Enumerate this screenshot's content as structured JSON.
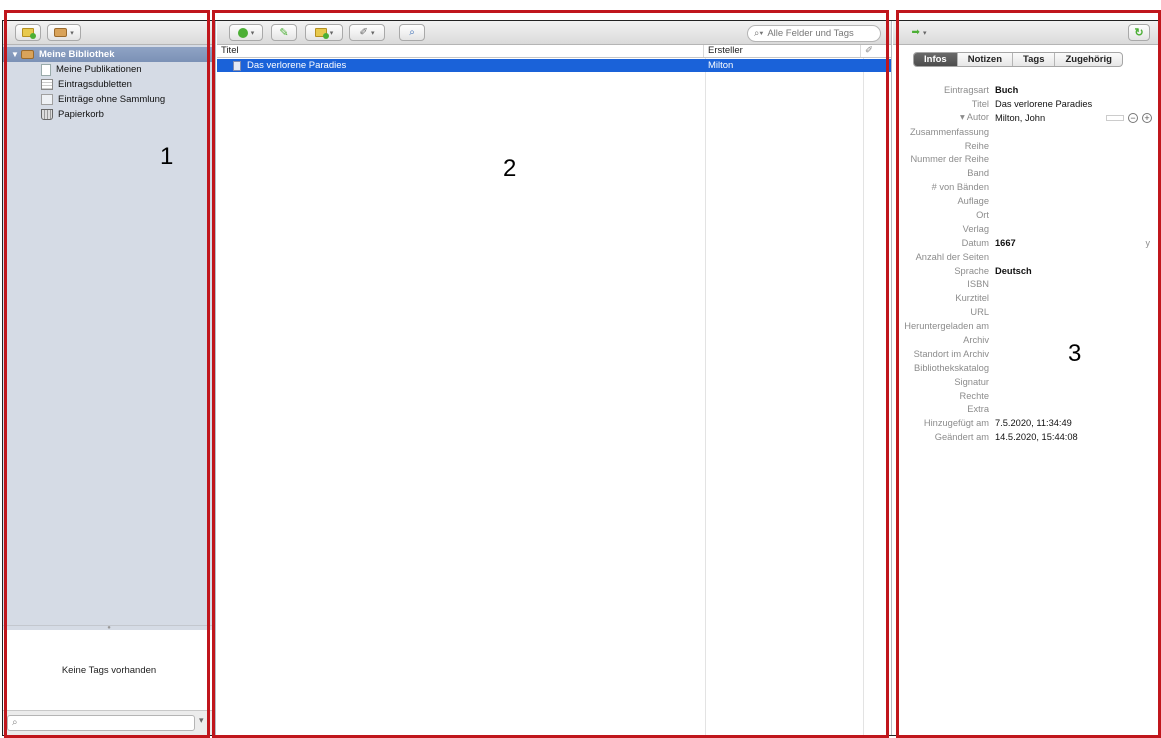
{
  "left_pane": {
    "library": "Meine Bibliothek",
    "items": [
      {
        "label": "Meine Publikationen"
      },
      {
        "label": "Eintragsdubletten"
      },
      {
        "label": "Einträge ohne Sammlung"
      },
      {
        "label": "Papierkorb"
      }
    ],
    "tags_empty": "Keine Tags vorhanden",
    "tag_search_glyph": "⌕"
  },
  "middle_pane": {
    "search_placeholder": "Alle Felder und Tags",
    "columns": {
      "title": "Titel",
      "creator": "Ersteller"
    },
    "rows": [
      {
        "title": "Das verlorene Paradies",
        "creator": "Milton"
      }
    ]
  },
  "right_pane": {
    "tabs": [
      "Infos",
      "Notizen",
      "Tags",
      "Zugehörig"
    ],
    "fields": [
      {
        "label": "Eintragsart",
        "value": "Buch"
      },
      {
        "label": "Titel",
        "value": "Das verlorene Paradies"
      },
      {
        "label": "▾ Autor",
        "value": "Milton, John"
      },
      {
        "label": "Zusammenfassung",
        "value": ""
      },
      {
        "label": "Reihe",
        "value": ""
      },
      {
        "label": "Nummer der Reihe",
        "value": ""
      },
      {
        "label": "Band",
        "value": ""
      },
      {
        "label": "# von Bänden",
        "value": ""
      },
      {
        "label": "Auflage",
        "value": ""
      },
      {
        "label": "Ort",
        "value": ""
      },
      {
        "label": "Verlag",
        "value": ""
      },
      {
        "label": "Datum",
        "value": "1667"
      },
      {
        "label": "Anzahl der Seiten",
        "value": ""
      },
      {
        "label": "Sprache",
        "value": "Deutsch"
      },
      {
        "label": "ISBN",
        "value": ""
      },
      {
        "label": "Kurztitel",
        "value": ""
      },
      {
        "label": "URL",
        "value": ""
      },
      {
        "label": "Heruntergeladen am",
        "value": ""
      },
      {
        "label": "Archiv",
        "value": ""
      },
      {
        "label": "Standort im Archiv",
        "value": ""
      },
      {
        "label": "Bibliothekskatalog",
        "value": ""
      },
      {
        "label": "Signatur",
        "value": ""
      },
      {
        "label": "Rechte",
        "value": ""
      },
      {
        "label": "Extra",
        "value": ""
      },
      {
        "label": "Hinzugefügt am",
        "value": "7.5.2020, 11:34:49"
      },
      {
        "label": "Geändert am",
        "value": "14.5.2020, 15:44:08"
      }
    ],
    "date_hint": "y"
  },
  "annotations": {
    "labels": [
      "1",
      "2",
      "3"
    ],
    "color": "#c0161c"
  },
  "colors": {
    "selection": "#1a62d9",
    "sidebar": "#d5dbe5",
    "accent_green": "#4caf35"
  }
}
